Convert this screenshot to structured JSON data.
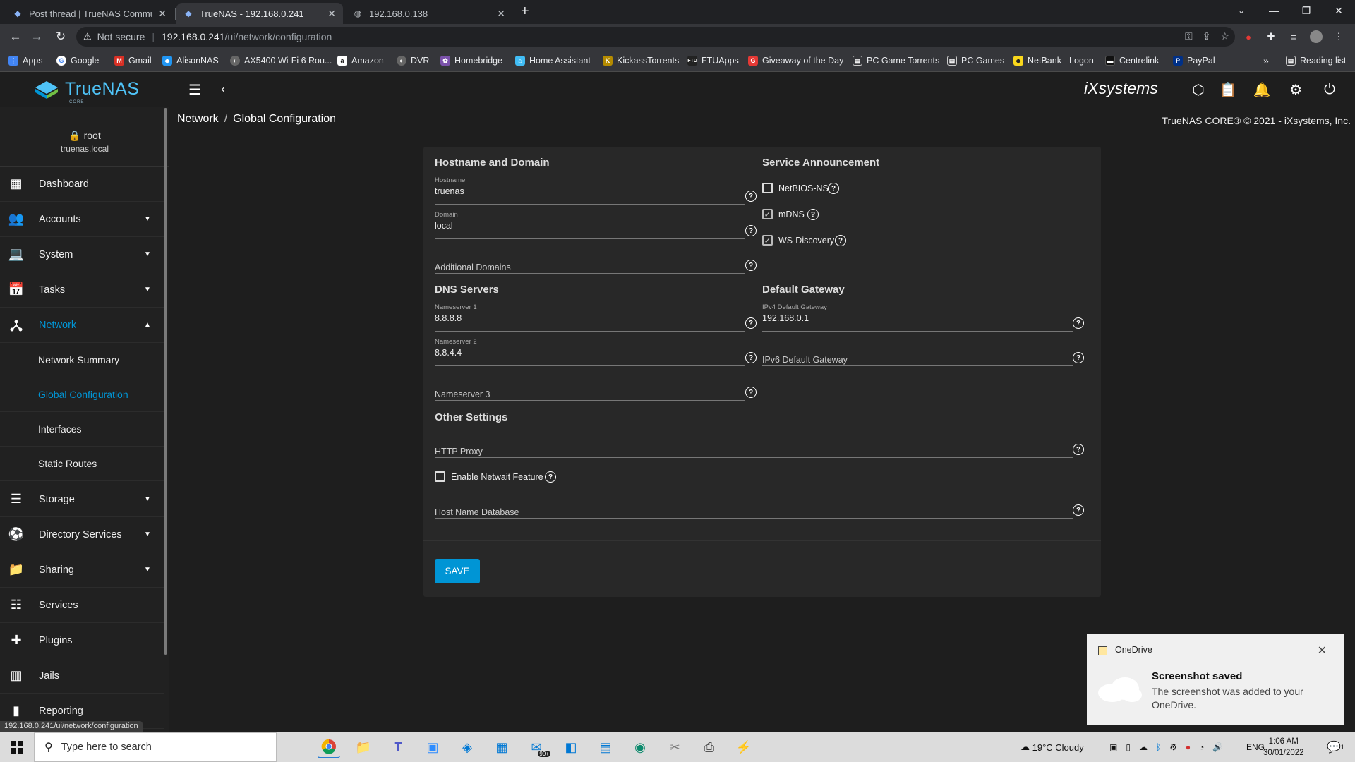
{
  "browser": {
    "tabs": [
      {
        "title": "Post thread | TrueNAS Communit",
        "icon": "truenas-icon"
      },
      {
        "title": "TrueNAS - 192.168.0.241",
        "icon": "truenas-icon"
      },
      {
        "title": "192.168.0.138",
        "icon": "globe-icon"
      }
    ],
    "new_tab": "+",
    "security": "Not secure",
    "url_host": "192.168.0.241",
    "url_path": "/ui/network/configuration",
    "bookmarks": [
      {
        "label": "Apps",
        "color": "#4285f4",
        "glyph": "⋮⋮"
      },
      {
        "label": "Google",
        "color": "#4285f4",
        "glyph": "G"
      },
      {
        "label": "Gmail",
        "color": "#d93025",
        "glyph": "M"
      },
      {
        "label": "AlisonNAS",
        "color": "#2196f3",
        "glyph": "◆"
      },
      {
        "label": "AX5400 Wi-Fi 6 Rou...",
        "color": "#555",
        "glyph": "◐"
      },
      {
        "label": "Amazon",
        "color": "#222",
        "glyph": "a"
      },
      {
        "label": "DVR",
        "color": "#555",
        "glyph": "◐"
      },
      {
        "label": "Homebridge",
        "color": "#7b52ab",
        "glyph": "✿"
      },
      {
        "label": "Home Assistant",
        "color": "#41bdf5",
        "glyph": "⌂"
      },
      {
        "label": "KickassTorrents",
        "color": "#b58b00",
        "glyph": "K"
      },
      {
        "label": "FTUApps",
        "color": "#333",
        "glyph": "F"
      },
      {
        "label": "Giveaway of the Day",
        "color": "#e53935",
        "glyph": "G"
      },
      {
        "label": "PC Game Torrents",
        "color": "#444",
        "glyph": "▤"
      },
      {
        "label": "PC Games",
        "color": "#444",
        "glyph": "▤"
      },
      {
        "label": "NetBank - Logon",
        "color": "#f9d71c",
        "glyph": "◆"
      },
      {
        "label": "Centrelink",
        "color": "#111",
        "glyph": "▬"
      },
      {
        "label": "PayPal",
        "color": "#003087",
        "glyph": "P"
      }
    ],
    "bookmarks_more": "»",
    "reading_list": "Reading list",
    "status_url": "192.168.0.241/ui/network/configuration"
  },
  "app": {
    "logo": "TrueNAS",
    "logo_sub": "CORE",
    "vendor": "iXsystems",
    "user": {
      "name": "root",
      "host": "truenas.local"
    },
    "breadcrumb": [
      "Network",
      "Global Configuration"
    ],
    "copyright": "TrueNAS CORE® © 2021 - iXsystems, Inc.",
    "accent": "#0095d5"
  },
  "sidebar": {
    "items": [
      {
        "label": "Dashboard",
        "icon": "dashboard-icon",
        "glyph": "▦"
      },
      {
        "label": "Accounts",
        "icon": "accounts-icon",
        "glyph": "👥",
        "caret": "▼"
      },
      {
        "label": "System",
        "icon": "laptop-icon",
        "glyph": "💻",
        "caret": "▼"
      },
      {
        "label": "Tasks",
        "icon": "calendar-icon",
        "glyph": "📅",
        "caret": "▼"
      },
      {
        "label": "Network",
        "icon": "network-icon",
        "glyph": "⅄",
        "caret": "▲"
      },
      {
        "label": "Storage",
        "icon": "storage-icon",
        "glyph": "☰",
        "caret": "▼"
      },
      {
        "label": "Directory Services",
        "icon": "directory-icon",
        "glyph": "⚽",
        "caret": "▼"
      },
      {
        "label": "Sharing",
        "icon": "folder-share-icon",
        "glyph": "📁",
        "caret": "▼"
      },
      {
        "label": "Services",
        "icon": "tune-icon",
        "glyph": "☷"
      },
      {
        "label": "Plugins",
        "icon": "puzzle-icon",
        "glyph": "✚"
      },
      {
        "label": "Jails",
        "icon": "jail-icon",
        "glyph": "▥"
      },
      {
        "label": "Reporting",
        "icon": "chart-icon",
        "glyph": "▮"
      }
    ],
    "network_sub": [
      "Network Summary",
      "Global Configuration",
      "Interfaces",
      "Static Routes"
    ]
  },
  "form": {
    "hostname_section": "Hostname and Domain",
    "hostname_label": "Hostname",
    "hostname_value": "truenas",
    "domain_label": "Domain",
    "domain_value": "local",
    "additional_domains": "Additional Domains",
    "dns_section": "DNS Servers",
    "ns1_label": "Nameserver 1",
    "ns1_value": "8.8.8.8",
    "ns2_label": "Nameserver 2",
    "ns2_value": "8.8.4.4",
    "ns3_placeholder": "Nameserver 3",
    "service_section": "Service Announcement",
    "netbios": "NetBIOS-NS",
    "netbios_checked": false,
    "mdns": "mDNS",
    "mdns_checked": true,
    "wsd": "WS-Discovery",
    "wsd_checked": true,
    "gateway_section": "Default Gateway",
    "ipv4_label": "IPv4 Default Gateway",
    "ipv4_value": "192.168.0.1",
    "ipv6_placeholder": "IPv6 Default Gateway",
    "other_section": "Other Settings",
    "http_proxy": "HTTP Proxy",
    "netwait": "Enable Netwait Feature",
    "netwait_checked": false,
    "hosts_db": "Host Name Database",
    "save": "SAVE",
    "help_glyph": "?"
  },
  "toast": {
    "app": "OneDrive",
    "title": "Screenshot saved",
    "body": "The screenshot was added to your OneDrive.",
    "close": "✕"
  },
  "taskbar": {
    "search_placeholder": "Type here to search",
    "weather": "19°C  Cloudy",
    "lang": "ENG",
    "time": "1:06 AM",
    "date": "30/01/2022",
    "notif_badge": "99+",
    "action_badge": "1"
  }
}
